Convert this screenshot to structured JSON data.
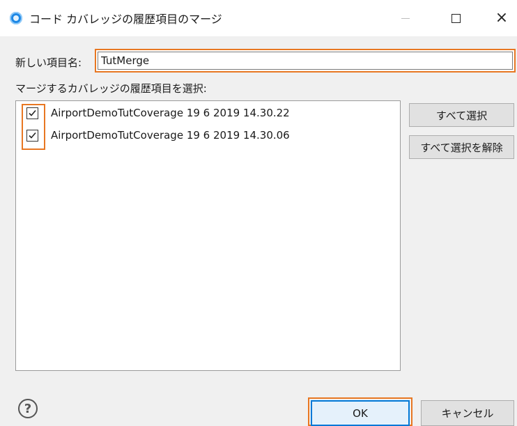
{
  "window": {
    "title": "コード カバレッジの履歴項目のマージ",
    "controls": {
      "minimize": "—",
      "maximize": "□",
      "close": "×"
    }
  },
  "form": {
    "name_label": "新しい項目名:",
    "name_value": "TutMerge",
    "select_label": "マージするカバレッジの履歴項目を選択:"
  },
  "history_items": [
    {
      "label": "AirportDemoTutCoverage  19 6 2019 14.30.22",
      "checked": true
    },
    {
      "label": "AirportDemoTutCoverage  19 6 2019 14.30.06",
      "checked": true
    }
  ],
  "buttons": {
    "select_all": "すべて選択",
    "deselect_all": "すべて選択を解除",
    "ok": "OK",
    "cancel": "キャンセル",
    "help": "?"
  },
  "colors": {
    "highlight": "#e87722",
    "app_icon": "#1e88e5",
    "ok_border": "#0078d7"
  }
}
